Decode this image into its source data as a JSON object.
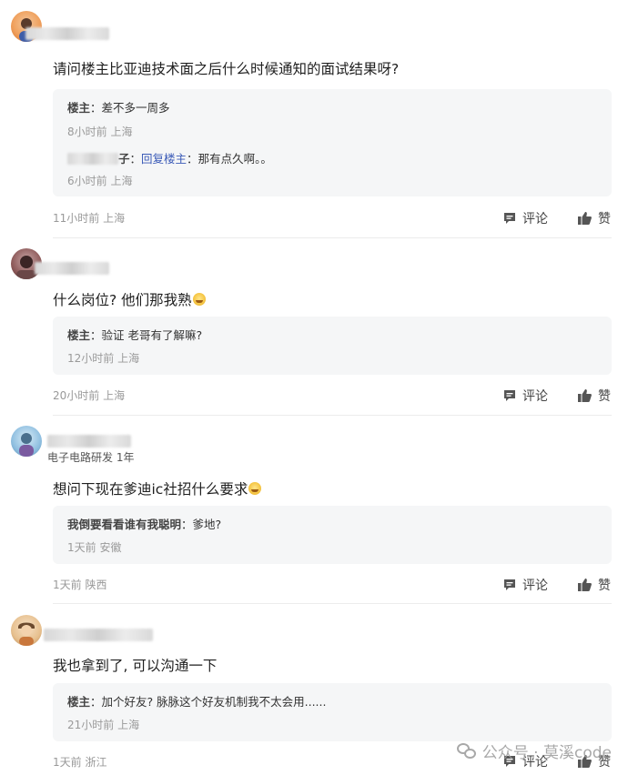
{
  "actions": {
    "comment_label": "评论",
    "like_label": "赞"
  },
  "comments": [
    {
      "content": "请问楼主比亚迪技术面之后什么时候通知的面试结果呀?",
      "replies": [
        {
          "who": "楼主",
          "reply_to": "",
          "text": "差不多一周多",
          "meta": "8小时前 上海"
        },
        {
          "who_partial": "子",
          "reply_to": "回复楼主",
          "text": "那有点久啊。。",
          "meta": "6小时前 上海"
        }
      ],
      "meta": "11小时前 上海"
    },
    {
      "content": "什么岗位? 他们那我熟",
      "replies": [
        {
          "who": "楼主",
          "text": "验证 老哥有了解嘛?",
          "meta": "12小时前 上海"
        }
      ],
      "meta": "20小时前 上海"
    },
    {
      "subtitle": "电子电路研发 1年",
      "content": "想问下现在爹迪ic社招什么要求",
      "replies": [
        {
          "who": "我倒要看看谁有我聪明",
          "text": "爹地?",
          "meta": "1天前 安徽"
        }
      ],
      "meta": "1天前 陕西"
    },
    {
      "content": "我也拿到了, 可以沟通一下",
      "replies": [
        {
          "who": "楼主",
          "text": "加个好友? 脉脉这个好友机制我不太会用......",
          "meta": "21小时前 上海"
        }
      ],
      "meta": "1天前 浙江"
    }
  ],
  "watermark": {
    "text": "公众号 · 莫溪code"
  }
}
